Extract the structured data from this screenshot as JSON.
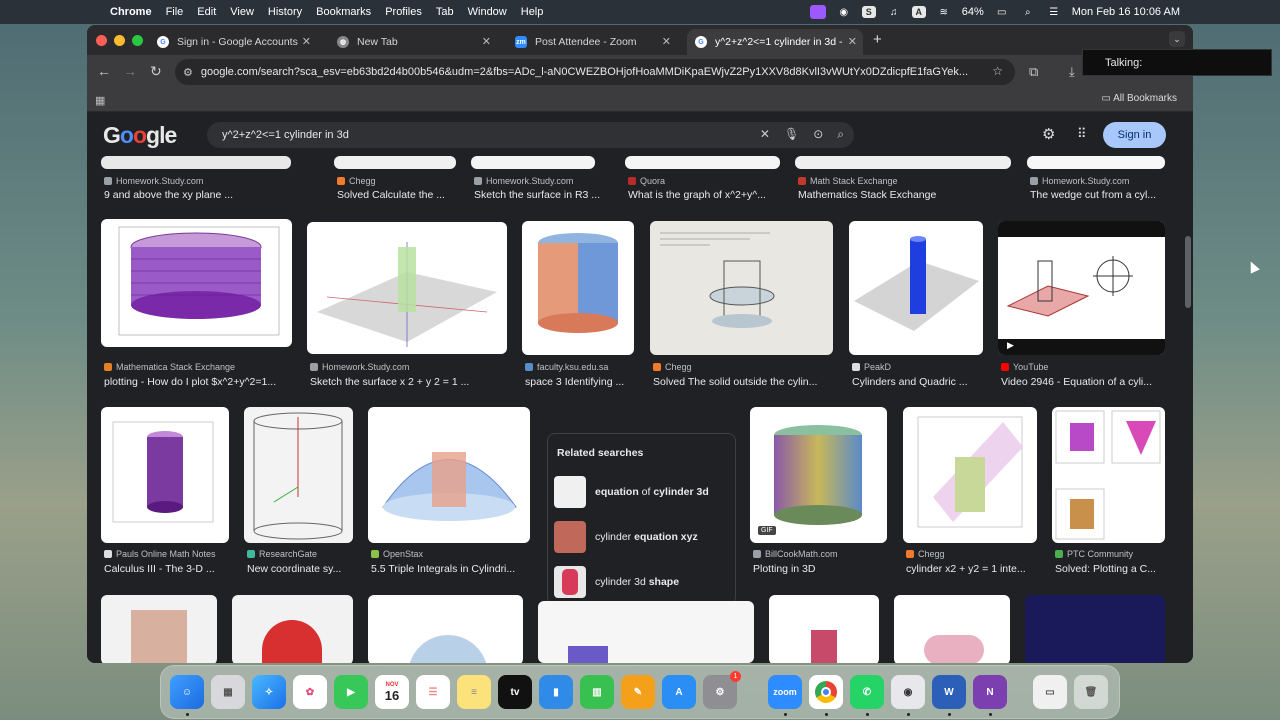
{
  "menubar": {
    "app": "Chrome",
    "items": [
      "File",
      "Edit",
      "View",
      "History",
      "Bookmarks",
      "Profiles",
      "Tab",
      "Window",
      "Help"
    ],
    "battery": "64%",
    "datetime": "Mon Feb 16  10:06 AM"
  },
  "tabs": [
    {
      "label": "Sign in - Google Accounts"
    },
    {
      "label": "New Tab"
    },
    {
      "label": "Post Attendee - Zoom"
    },
    {
      "label": "y^2+z^2<=1 cylinder in 3d - "
    }
  ],
  "toolbar": {
    "url": "google.com/search?sca_esv=eb63bd2d4b00b546&udm=2&fbs=ADc_l-aN0CWEZBOHjofHoaMMDiKpaEWjvZ2Py1XXV8d8KvlI3vWUtYx0DZdicpfE1faGYek..."
  },
  "bookmarks": {
    "all_label": "All Bookmarks"
  },
  "zoom_overlay": {
    "label": "Talking:"
  },
  "google": {
    "query": "y^2+z^2<=1 cylinder in 3d",
    "signin_label": "Sign in"
  },
  "row0": [
    {
      "source": "Homework.Study.com",
      "title": "9 and above the xy plane ..."
    },
    {
      "source": "Chegg",
      "title": "Solved Calculate the ..."
    },
    {
      "source": "Homework.Study.com",
      "title": "Sketch the surface in R3 ..."
    },
    {
      "source": "Quora",
      "title": "What is the graph of x^2+y^..."
    },
    {
      "source": "Math Stack Exchange",
      "title": "Mathematics Stack Exchange"
    },
    {
      "source": "Homework.Study.com",
      "title": "The wedge cut from a cyl..."
    }
  ],
  "row1": [
    {
      "source": "Mathematica Stack Exchange",
      "title": "plotting - How do I plot $x^2+y^2=1..."
    },
    {
      "source": "Homework.Study.com",
      "title": "Sketch the surface x 2 + y 2 = 1 ..."
    },
    {
      "source": "faculty.ksu.edu.sa",
      "title": "space 3 Identifying ..."
    },
    {
      "source": "Chegg",
      "title": "Solved The solid outside the cylin..."
    },
    {
      "source": "PeakD",
      "title": "Cylinders and Quadric ..."
    },
    {
      "source": "YouTube",
      "title": "Video 2946 - Equation of a cyli..."
    }
  ],
  "row2": [
    {
      "source": "Pauls Online Math Notes",
      "title": "Calculus III - The 3-D ..."
    },
    {
      "source": "ResearchGate",
      "title": "New coordinate sy..."
    },
    {
      "source": "OpenStax",
      "title": "5.5 Triple Integrals in Cylindri..."
    },
    {
      "source": "BillCookMath.com",
      "title": "Plotting in 3D"
    },
    {
      "source": "Chegg",
      "title": "cylinder x2 + y2 = 1 inte..."
    },
    {
      "source": "PTC Community",
      "title": "Solved: Plotting a C..."
    }
  ],
  "related": {
    "heading": "Related searches",
    "items": [
      {
        "pre": "",
        "bold": "equation",
        "mid": " of ",
        "bold2": "cylinder 3d"
      },
      {
        "pre": "cylinder ",
        "bold": "equation xyz",
        "mid": "",
        "bold2": ""
      },
      {
        "pre": "cylinder 3d ",
        "bold": "shape",
        "mid": "",
        "bold2": ""
      }
    ]
  },
  "dock": {
    "calendar_day": "16",
    "calendar_month": "NOV",
    "badge": "1",
    "zoom_label": "zoom"
  },
  "gif_badge": "GIF",
  "colors": {
    "accent": "#a8c7fa",
    "page_bg": "#202124"
  }
}
